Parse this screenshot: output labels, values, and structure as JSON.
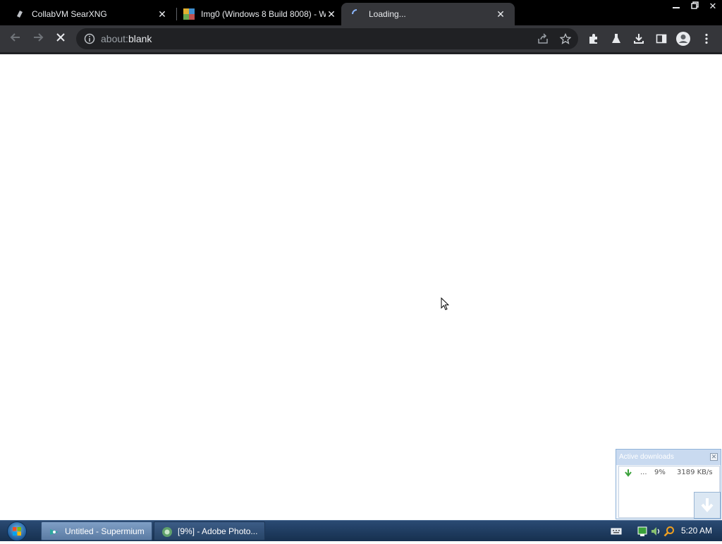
{
  "browser": {
    "tabs": [
      {
        "title": "CollabVM SearXNG",
        "icon": "searxng-icon",
        "active": false
      },
      {
        "title": "Img0 (Windows 8 Build 8008) - W",
        "icon": "wallpaper-thumbnail-icon",
        "active": false
      },
      {
        "title": "Loading...",
        "icon": "loading-spinner-icon",
        "active": true
      }
    ],
    "omnibox": {
      "scheme": "about:",
      "host": "blank",
      "icon": "info-icon"
    },
    "colors": {
      "tabstrip": "#000000",
      "toolbar": "#35363a",
      "omnibox": "#202124",
      "text": "#e8eaed",
      "muted": "#9aa0a6"
    }
  },
  "download_panel": {
    "header": "Active downloads",
    "row": {
      "name": "...",
      "percent": "9%",
      "speed": "3189 KB/s"
    }
  },
  "taskbar": {
    "buttons": [
      {
        "label": "Untitled - Supermium",
        "active": true
      },
      {
        "label": "[9%] - Adobe Photo...",
        "active": false
      }
    ],
    "clock": "5:20 AM"
  }
}
